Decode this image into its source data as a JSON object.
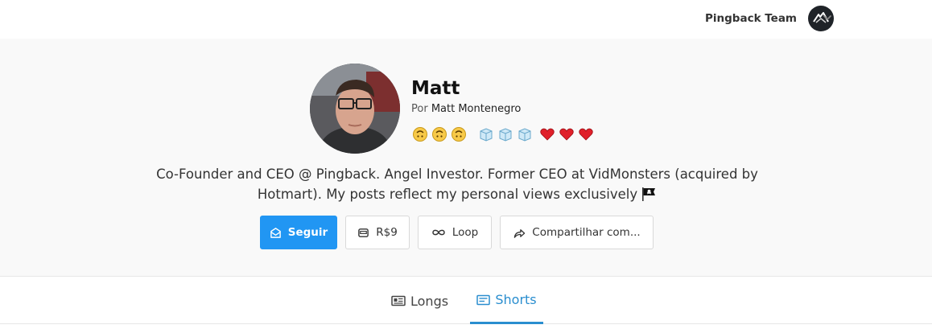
{
  "header": {
    "team_name": "Pingback Team"
  },
  "profile": {
    "name": "Matt",
    "by_prefix": "Por",
    "author": "Matt Montenegro",
    "badges": [
      "upside-down-face",
      "upside-down-face",
      "upside-down-face",
      "ice-cube",
      "ice-cube",
      "ice-cube",
      "red-heart",
      "red-heart",
      "red-heart"
    ],
    "bio": "Co-Founder and CEO @ Pingback. Angel Investor. Former CEO at VidMonsters (acquired by Hotmart). My posts reflect my personal views exclusively",
    "bio_emoji": "pirate-flag"
  },
  "actions": {
    "follow_label": "Seguir",
    "price_label": "R$9",
    "loop_label": "Loop",
    "share_label": "Compartilhar com..."
  },
  "tabs": [
    {
      "label": "Longs",
      "icon": "newspaper-icon",
      "active": false
    },
    {
      "label": "Shorts",
      "icon": "card-icon",
      "active": true
    }
  ],
  "colors": {
    "accent": "#2196f3",
    "tab_active": "#2a8ecf",
    "profile_bg": "#f9f9f9"
  }
}
